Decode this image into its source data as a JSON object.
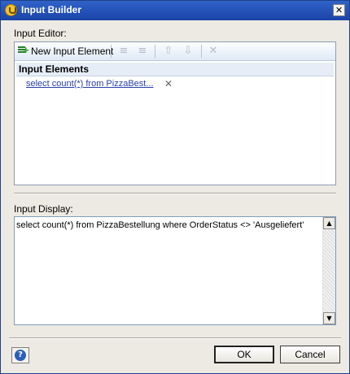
{
  "window": {
    "title": "Input Builder",
    "close_glyph": "✕"
  },
  "editor": {
    "label": "Input Editor:",
    "toolbar": {
      "new_input": "New Input Element",
      "icons": [
        "add-element-icon",
        "indent-icon",
        "outdent-icon",
        "move-up-icon",
        "move-down-icon",
        "delete-icon"
      ]
    },
    "list_header": "Input Elements",
    "items": [
      "select count(*) from PizzaBest..."
    ],
    "remove_glyph": "✕"
  },
  "display": {
    "label": "Input Display:",
    "text": "select count(*) from PizzaBestellung where OrderStatus <> 'Ausgeliefert'"
  },
  "buttons": {
    "ok": "OK",
    "cancel": "Cancel",
    "help_glyph": "?"
  },
  "colors": {
    "titlebar": "#2f63c8",
    "link": "#2a3fa6",
    "help": "#2b5fb8"
  }
}
